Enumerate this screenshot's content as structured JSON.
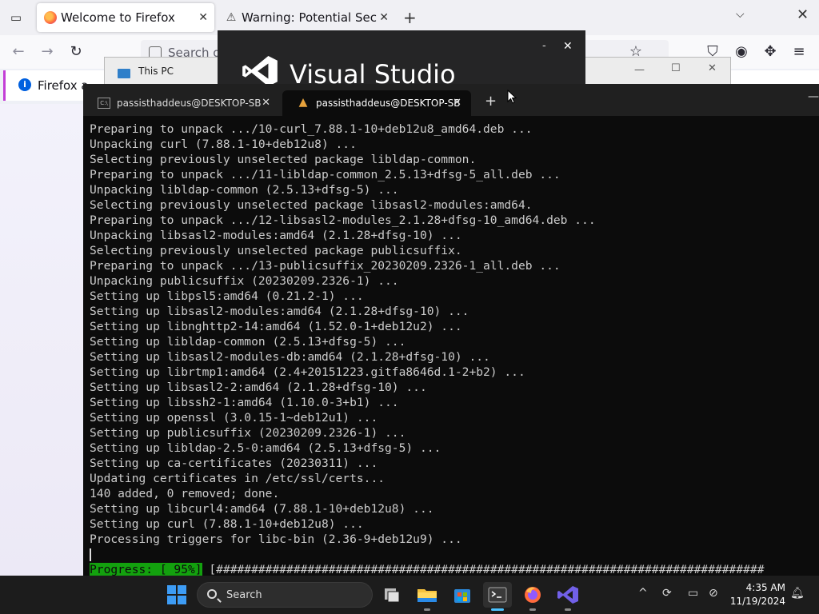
{
  "firefox": {
    "tabs": [
      {
        "title": "Welcome to Firefox",
        "close": "✕"
      },
      {
        "title": "Warning: Potential Sec",
        "close": "✕"
      }
    ],
    "new_tab": "+",
    "list_all_tabs": "⌵",
    "window_close": "✕",
    "search_placeholder": "Search o",
    "notification_text": "Firefox a",
    "notification_info": "i"
  },
  "explorer": {
    "title": "This PC",
    "minimize": "—",
    "maximize": "☐",
    "close": "✕"
  },
  "visual_studio": {
    "title": "Visual Studio",
    "minimize": "-",
    "close": "✕"
  },
  "terminal": {
    "tabs": [
      {
        "title": "passisthaddeus@DESKTOP-SB",
        "close": "✕",
        "icon": "cmd-icon"
      },
      {
        "title": "passisthaddeus@DESKTOP-SB",
        "close": "✕",
        "icon": "debian-icon"
      }
    ],
    "new_tab": "+",
    "minimize": "—",
    "lines": [
      "Preparing to unpack .../10-curl_7.88.1-10+deb12u8_amd64.deb ...",
      "Unpacking curl (7.88.1-10+deb12u8) ...",
      "Selecting previously unselected package libldap-common.",
      "Preparing to unpack .../11-libldap-common_2.5.13+dfsg-5_all.deb ...",
      "Unpacking libldap-common (2.5.13+dfsg-5) ...",
      "Selecting previously unselected package libsasl2-modules:amd64.",
      "Preparing to unpack .../12-libsasl2-modules_2.1.28+dfsg-10_amd64.deb ...",
      "Unpacking libsasl2-modules:amd64 (2.1.28+dfsg-10) ...",
      "Selecting previously unselected package publicsuffix.",
      "Preparing to unpack .../13-publicsuffix_20230209.2326-1_all.deb ...",
      "Unpacking publicsuffix (20230209.2326-1) ...",
      "Setting up libpsl5:amd64 (0.21.2-1) ...",
      "Setting up libsasl2-modules:amd64 (2.1.28+dfsg-10) ...",
      "Setting up libnghttp2-14:amd64 (1.52.0-1+deb12u2) ...",
      "Setting up libldap-common (2.5.13+dfsg-5) ...",
      "Setting up libsasl2-modules-db:amd64 (2.1.28+dfsg-10) ...",
      "Setting up librtmp1:amd64 (2.4+20151223.gitfa8646d.1-2+b2) ...",
      "Setting up libsasl2-2:amd64 (2.1.28+dfsg-10) ...",
      "Setting up libssh2-1:amd64 (1.10.0-3+b1) ...",
      "Setting up openssl (3.0.15-1~deb12u1) ...",
      "Setting up publicsuffix (20230209.2326-1) ...",
      "Setting up libldap-2.5-0:amd64 (2.5.13+dfsg-5) ...",
      "Setting up ca-certificates (20230311) ...",
      "Updating certificates in /etc/ssl/certs...",
      "140 added, 0 removed; done.",
      "Setting up libcurl4:amd64 (7.88.1-10+deb12u8) ...",
      "Setting up curl (7.88.1-10+deb12u8) ...",
      "Processing triggers for libc-bin (2.36-9+deb12u9) ..."
    ],
    "progress": {
      "label": "Progress: [ 95%]",
      "bar": " [##############################################################################",
      "percent": 95
    }
  },
  "taskbar": {
    "search_label": "Search",
    "apps": [
      "task-view",
      "file-explorer",
      "microsoft-store",
      "terminal",
      "firefox",
      "visual-studio"
    ],
    "clock_time": "4:35 AM",
    "clock_date": "11/19/2024",
    "tray": {
      "overflow": "^"
    }
  },
  "colors": {
    "terminal_bg": "#0c0c0c",
    "terminal_fg": "#cccccc",
    "progress_green": "#13a10e",
    "vs_purple": "#7160e8",
    "taskbar_bg": "#1c1c1c"
  }
}
